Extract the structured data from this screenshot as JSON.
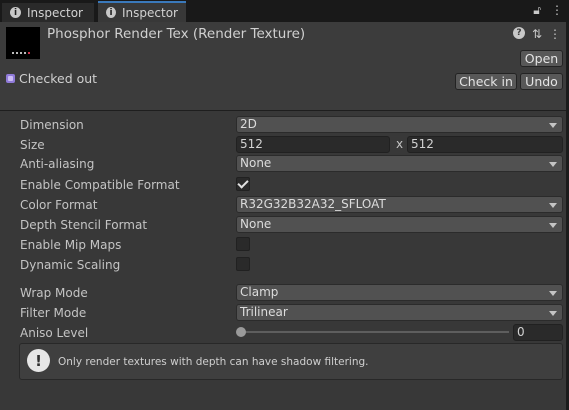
{
  "tabs": [
    {
      "label": "Inspector",
      "icon": "info-icon"
    },
    {
      "label": "Inspector",
      "icon": "info-icon"
    }
  ],
  "tab_tools": {
    "lock_icon": "lock-icon",
    "menu_icon": "kebab-menu-icon"
  },
  "header": {
    "asset_title": "Phosphor Render Tex (Render Texture)",
    "open_label": "Open",
    "checked_out_label": "Checked out",
    "check_in_label": "Check in",
    "undo_label": "Undo",
    "icons": [
      "help-icon",
      "settings-sliders-icon",
      "kebab-menu-icon"
    ]
  },
  "props": {
    "dimension": {
      "label": "Dimension",
      "value": "2D"
    },
    "size": {
      "label": "Size",
      "width": "512",
      "x_sep": "x",
      "height": "512"
    },
    "anti_aliasing": {
      "label": "Anti-aliasing",
      "value": "None"
    },
    "enable_compatible_format": {
      "label": "Enable Compatible Format",
      "checked": true
    },
    "color_format": {
      "label": "Color Format",
      "value": "R32G32B32A32_SFLOAT"
    },
    "depth_stencil_format": {
      "label": "Depth Stencil Format",
      "value": "None"
    },
    "enable_mip_maps": {
      "label": "Enable Mip Maps",
      "checked": false
    },
    "dynamic_scaling": {
      "label": "Dynamic Scaling",
      "checked": false
    },
    "wrap_mode": {
      "label": "Wrap Mode",
      "value": "Clamp"
    },
    "filter_mode": {
      "label": "Filter Mode",
      "value": "Trilinear"
    },
    "aniso_level": {
      "label": "Aniso Level",
      "value": "0",
      "slider_fraction": 0
    }
  },
  "help_box": {
    "text": "Only render textures with depth can have shadow filtering."
  },
  "colors": {
    "accent": "#3a79bb",
    "background": "#383838",
    "header": "#3c3c3c",
    "version_control": "#8f7ad8"
  }
}
